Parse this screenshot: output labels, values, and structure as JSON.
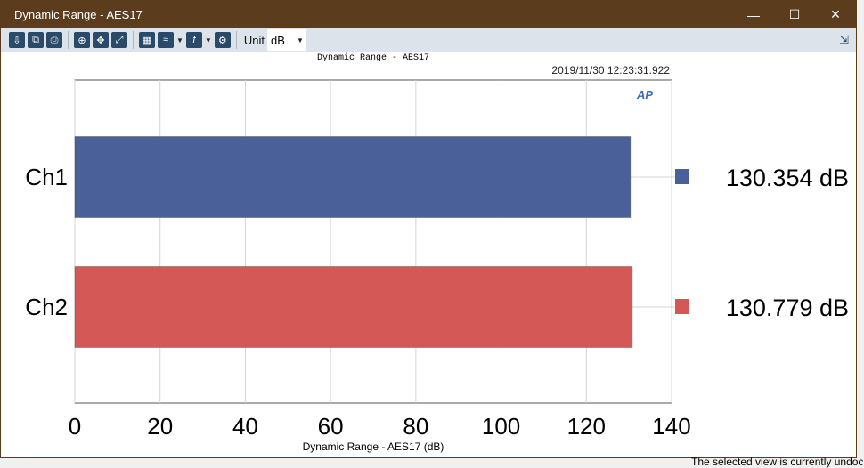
{
  "window": {
    "title": "Dynamic Range - AES17",
    "buttons": [
      "minimize",
      "maximize",
      "close"
    ]
  },
  "toolbar": {
    "icons": [
      "save-icon",
      "copy-icon",
      "print-icon",
      "zoom-icon",
      "pan-icon",
      "fit-icon",
      "table-icon",
      "graph-style-icon",
      "function-icon",
      "settings-icon"
    ],
    "unit_label": "Unit",
    "unit_value": "dB"
  },
  "status": "The selected view is currently undock",
  "chart_data": {
    "type": "bar",
    "orientation": "horizontal",
    "title": "Dynamic Range - AES17",
    "timestamp": "2019/11/30 12:23:31.922",
    "xlabel": "Dynamic Range - AES17 (dB)",
    "xlim": [
      0,
      140
    ],
    "xticks": [
      0,
      20,
      40,
      60,
      80,
      100,
      120,
      140
    ],
    "grid": true,
    "categories": [
      "Ch1",
      "Ch2"
    ],
    "values": [
      130.354,
      130.779
    ],
    "value_labels": [
      "130.354  dB",
      "130.779  dB"
    ],
    "colors": [
      "#4a6099",
      "#d45856"
    ],
    "legend": "right",
    "logo": "AP"
  }
}
